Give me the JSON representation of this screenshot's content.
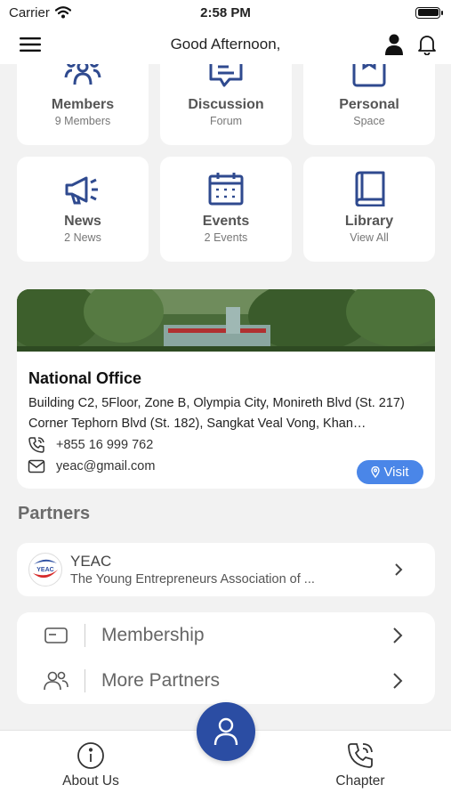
{
  "status_bar": {
    "carrier": "Carrier",
    "time": "2:58 PM"
  },
  "header": {
    "title": "Good Afternoon,"
  },
  "tiles": [
    {
      "title": "Members",
      "subtitle": "9 Members",
      "icon": "members-icon"
    },
    {
      "title": "Discussion",
      "subtitle": "Forum",
      "icon": "discussion-icon"
    },
    {
      "title": "Personal",
      "subtitle": "Space",
      "icon": "personal-icon"
    },
    {
      "title": "News",
      "subtitle": "2 News",
      "icon": "megaphone-icon"
    },
    {
      "title": "Events",
      "subtitle": "2 Events",
      "icon": "calendar-icon"
    },
    {
      "title": "Library",
      "subtitle": "View All",
      "icon": "book-icon"
    }
  ],
  "office": {
    "title": "National Office",
    "address": "Building C2, 5Floor, Zone B, Olympia City, Monireth Blvd (St. 217) Corner Tephorn Blvd (St. 182), Sangkat Veal Vong, Khan…",
    "phone": "+855 16 999 762",
    "email": "yeac@gmail.com",
    "visit_label": "Visit"
  },
  "partners": {
    "section_title": "Partners",
    "items": [
      {
        "name": "YEAC",
        "description": "The Young Entrepreneurs Association of ...",
        "logo_text": "YEAC"
      }
    ]
  },
  "menu": [
    {
      "label": "Membership",
      "icon": "card-icon"
    },
    {
      "label": "More Partners",
      "icon": "people-icon"
    }
  ],
  "tabbar": {
    "left_label": "About Us",
    "right_label": "Chapter"
  },
  "colors": {
    "accent": "#2b4da3",
    "icon_blue": "#2f4a8f",
    "visit_button": "#4a86e8",
    "background": "#f2f2f2"
  }
}
